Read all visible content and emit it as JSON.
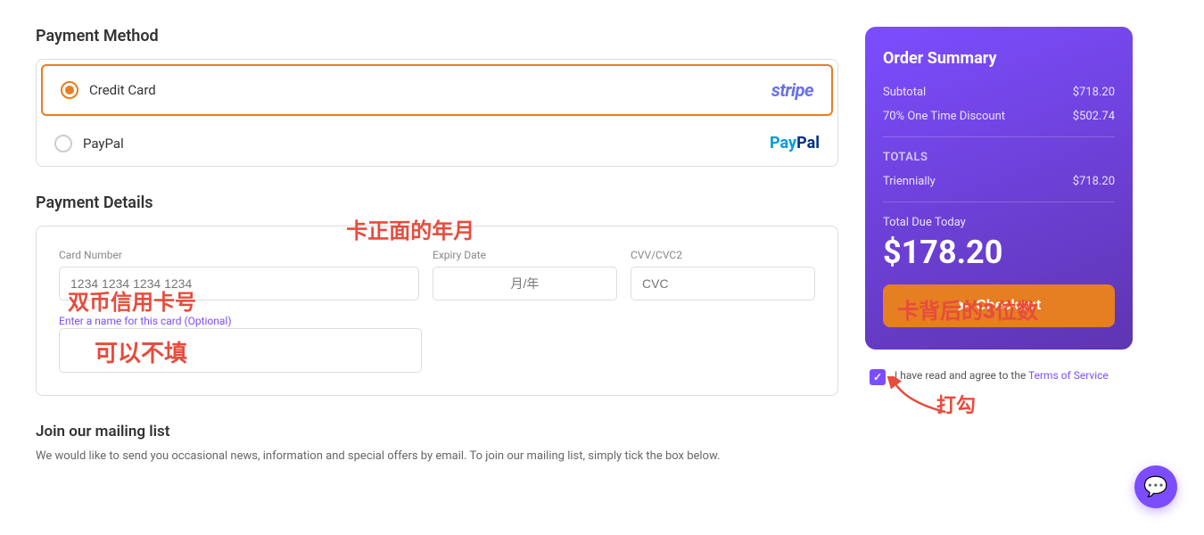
{
  "page": {
    "payment_method": {
      "title": "Payment Method",
      "options": [
        {
          "id": "credit-card",
          "label": "Credit Card",
          "logo": "stripe",
          "selected": true
        },
        {
          "id": "paypal",
          "label": "PayPal",
          "logo": "paypal",
          "selected": false
        }
      ]
    },
    "payment_details": {
      "title": "Payment Details",
      "fields": {
        "card_number": {
          "label": "Card Number",
          "placeholder": "1234 1234 1234 1234"
        },
        "expiry": {
          "label": "Expiry Date",
          "placeholder": "月/年"
        },
        "cvv": {
          "label": "CVV/CVC2",
          "placeholder": "CVC"
        },
        "card_name": {
          "label": "Enter a name for this card (Optional)",
          "placeholder": ""
        }
      },
      "annotations": {
        "card_number": "双币信用卡号",
        "expiry": "卡正面的年月",
        "cvv": "卡背后的3位数",
        "optional": "可以不填"
      }
    },
    "mailing": {
      "title": "Join our mailing list",
      "text": "We would like to send you occasional news, information and special offers by email. To join our mailing list, simply tick the box below."
    },
    "order_summary": {
      "title": "Order Summary",
      "subtotal_label": "Subtotal",
      "subtotal_value": "$718.20",
      "discount_label": "70% One Time Discount",
      "discount_value": "$502.74",
      "totals_label": "Totals",
      "triennially_label": "Triennially",
      "triennially_value": "$718.20",
      "total_due_label": "Total Due Today",
      "total_due_value": "$178.20",
      "checkout_label": "Checkout"
    },
    "terms": {
      "text_before": "I have read and agree to the ",
      "link_text": "Terms of Service",
      "text_after": "",
      "checked": true
    },
    "annotations": {
      "checkout_arrow": "打勾"
    }
  }
}
